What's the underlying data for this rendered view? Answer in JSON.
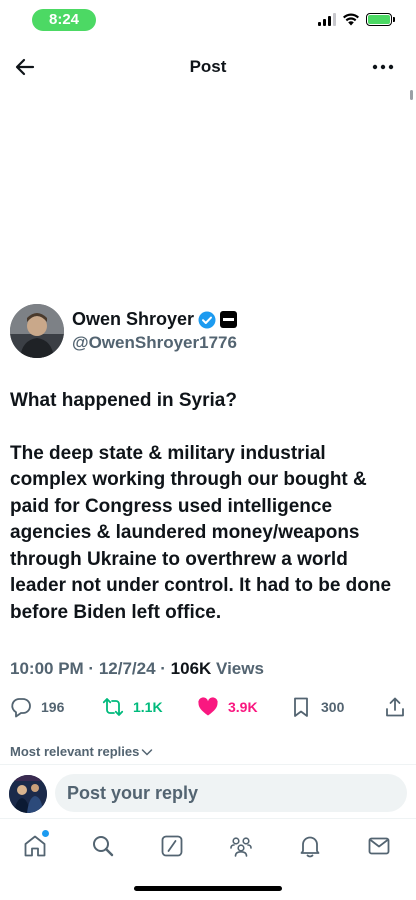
{
  "status_bar": {
    "time": "8:24"
  },
  "header": {
    "title": "Post"
  },
  "author": {
    "name": "Owen Shroyer",
    "handle": "@OwenShroyer1776"
  },
  "post": {
    "paragraph1": "What happened in Syria?",
    "paragraph2": "The deep state & military industrial complex working through our bought & paid for Congress used intelligence agencies & laundered money/weapons through Ukraine to overthrew a world leader not under control. It had to be done before Biden left office."
  },
  "meta": {
    "time": "10:00 PM",
    "date": "12/7/24",
    "views_count": "106K",
    "views_label": "Views"
  },
  "actions": {
    "replies": "196",
    "reposts": "1.1K",
    "likes": "3.9K",
    "bookmarks": "300"
  },
  "replies_sort": {
    "label": "Most relevant replies"
  },
  "composer": {
    "placeholder": "Post your reply"
  },
  "colors": {
    "verified": "#1d9bf0",
    "repost": "#00ba7c",
    "like": "#f91880",
    "time_pill": "#4cd964"
  },
  "nav": [
    "home-icon",
    "search-icon",
    "grok-icon",
    "communities-icon",
    "notifications-icon",
    "messages-icon"
  ]
}
